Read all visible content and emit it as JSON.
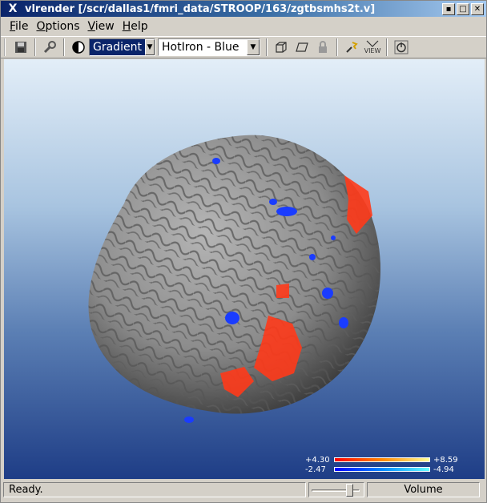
{
  "window": {
    "title": "vlrender [/scr/dallas1/fmri_data/STROOP/163/zgtbsmhs2t.v]",
    "logo": "X",
    "buttons": [
      "minimize",
      "maximize",
      "close"
    ]
  },
  "menu": [
    {
      "label": "File"
    },
    {
      "label": "Options"
    },
    {
      "label": "View"
    },
    {
      "label": "Help"
    }
  ],
  "toolbar": {
    "icons": [
      "save-icon",
      "tools-icon",
      "contrast-icon",
      "cube-icon",
      "plane-icon",
      "lock-icon",
      "light-icon",
      "view-icon",
      "power-icon"
    ],
    "view_label": "VIEW",
    "shading_mode": "Gradient",
    "colormap": "HotIron - Blue"
  },
  "legend": {
    "pos_low": "+4.30",
    "pos_high": "+8.59",
    "neg_low": "-2.47",
    "neg_high": "-4.94"
  },
  "status": {
    "text": "Ready.",
    "mode": "Volume",
    "slider_value": 0.85
  },
  "colors": {
    "title_bg": "#0a246a",
    "brain": "#8f8f8f",
    "activation_positive": "#ff3a1a",
    "activation_negative": "#1a3cff"
  }
}
